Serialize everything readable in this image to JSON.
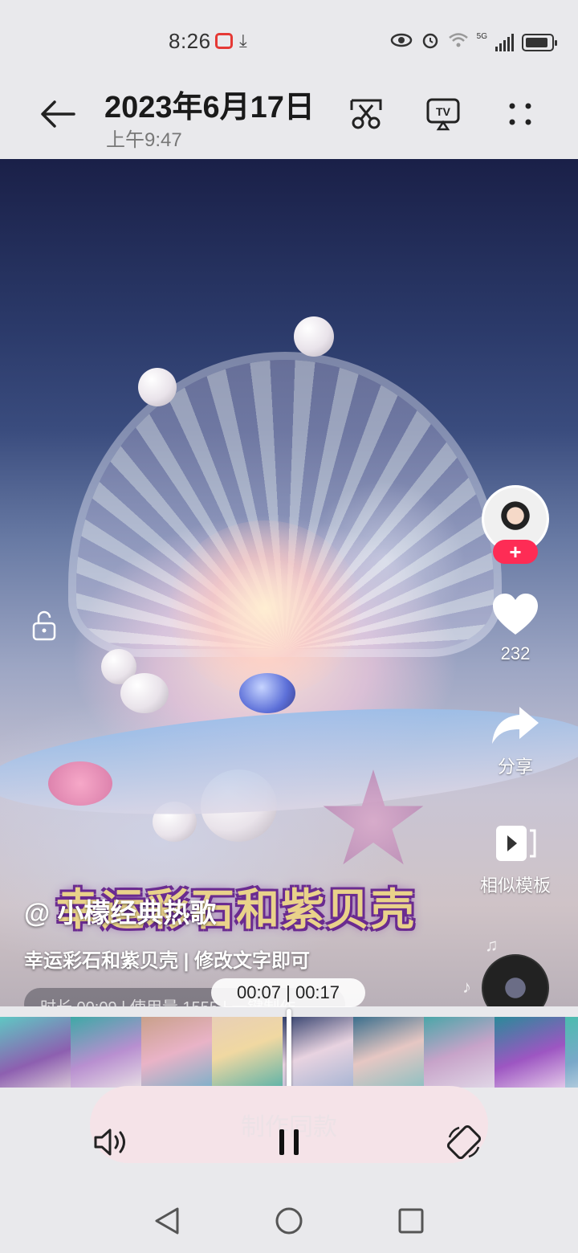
{
  "status_bar": {
    "time": "8:26",
    "network": "5G",
    "icons": [
      "notification-app-icon",
      "download-icon",
      "eye-icon",
      "alarm-icon",
      "wifi-icon",
      "signal-icon",
      "battery-icon"
    ]
  },
  "header": {
    "date": "2023年6月17日",
    "time": "上午9:47",
    "icons": [
      "back-arrow-icon",
      "scissors-icon",
      "tv-cast-icon",
      "more-icon"
    ]
  },
  "video": {
    "overlay_title": "幸运彩石和紫贝壳",
    "author": "@ 小檬经典热歌",
    "description": "幸运彩石和紫贝壳 | 修改文字即可",
    "meta_partial": "时长 00:09 | 使用量 1555 | 一键制作",
    "likes_count": "232",
    "share_label": "分享",
    "template_label": "相似模板"
  },
  "player": {
    "current_time": "00:07",
    "total_time": "00:17",
    "time_display": "00:07 | 00:17",
    "progress_fraction": 0.41,
    "make_same_label": "制作同款"
  },
  "colors": {
    "accent_red": "#fe2c55",
    "background": "#e9e9ec"
  },
  "nav_bar": {
    "icons": [
      "nav-back-icon",
      "nav-home-icon",
      "nav-recents-icon"
    ]
  }
}
